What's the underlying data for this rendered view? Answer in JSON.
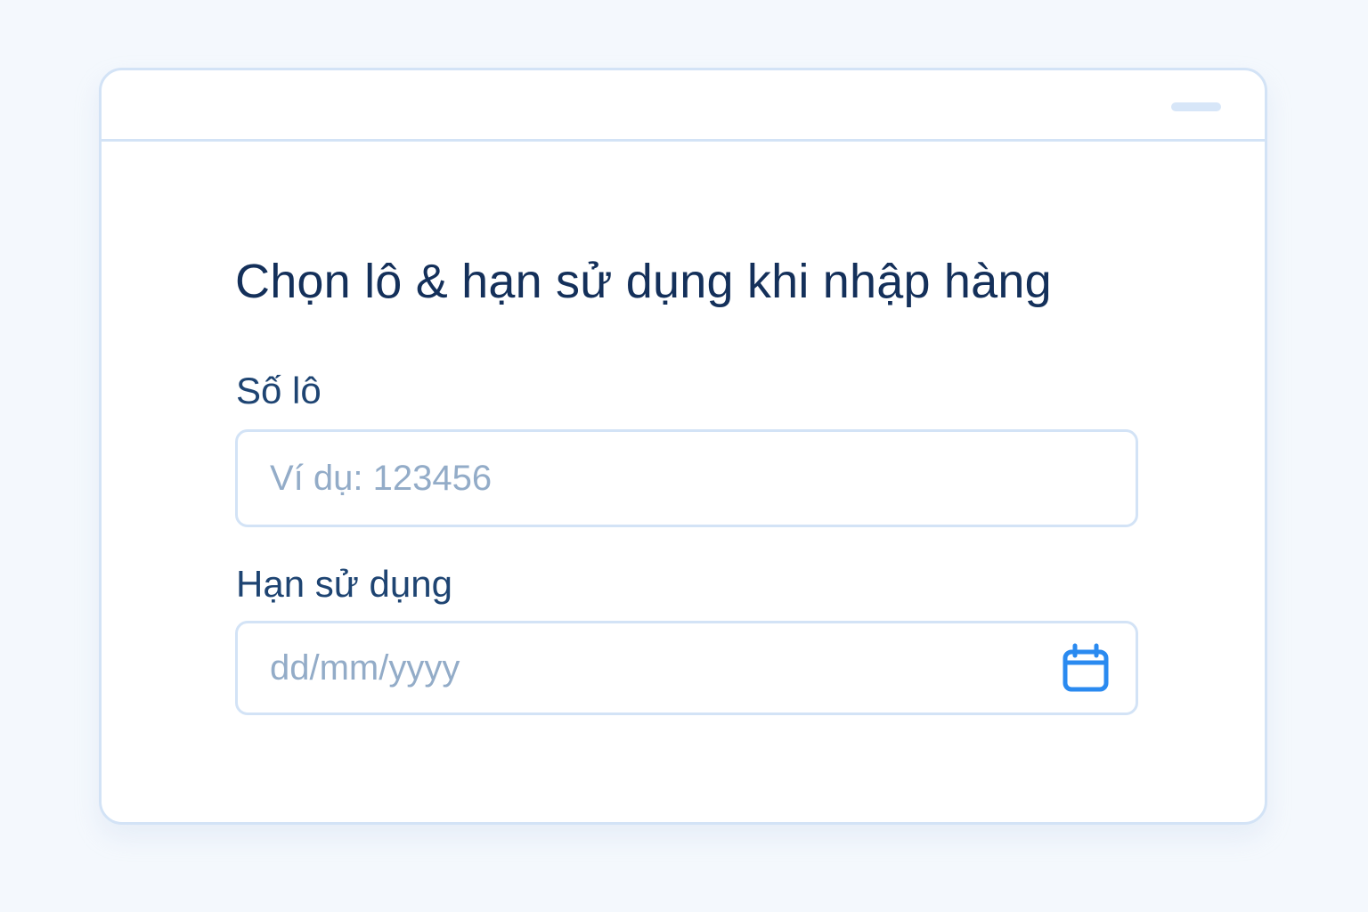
{
  "dialog": {
    "title": "Chọn lô & hạn sử dụng khi nhập hàng"
  },
  "fields": {
    "lot": {
      "label": "Số lô",
      "placeholder": "Ví dụ: 123456",
      "value": ""
    },
    "expiry": {
      "label": "Hạn sử dụng",
      "placeholder": "dd/mm/yyyy",
      "value": "",
      "icon": "calendar-icon"
    }
  },
  "colors": {
    "accent": "#2a8af0",
    "title": "#14305a",
    "label": "#1e4472",
    "placeholder": "#93acc8",
    "border": "#d3e3f6",
    "background": "#f4f8fd"
  }
}
